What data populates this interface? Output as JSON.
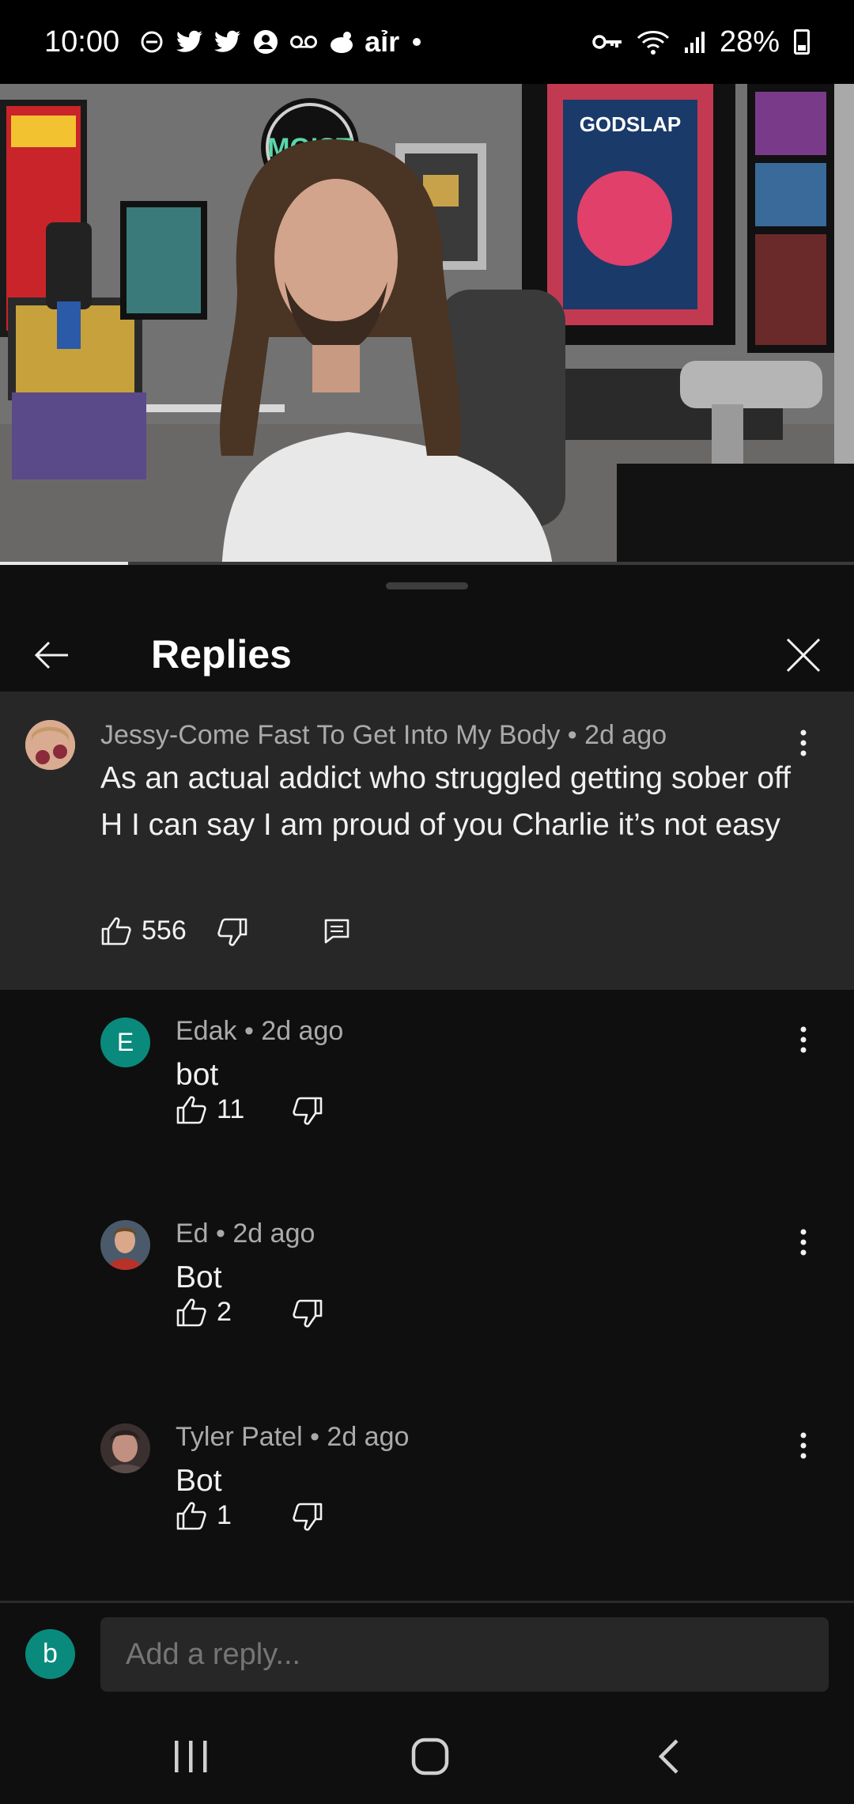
{
  "status_bar": {
    "time": "10:00",
    "battery": "28%",
    "left_icons": [
      "do-not-disturb-icon",
      "twitter-icon",
      "twitter-icon",
      "account-icon",
      "voicemail-icon",
      "notification-icon",
      "air-icon",
      "dot-icon"
    ],
    "right_icons": [
      "vpn-key-icon",
      "wifi-icon",
      "signal-icon",
      "battery-icon"
    ],
    "air_label": "aỉr"
  },
  "video": {
    "progress_percent": 15,
    "sign_text": "MOIST",
    "poster_text": "GODSLAP"
  },
  "sheet": {
    "title": "Replies"
  },
  "parent_comment": {
    "author": "Jessy-Come Fast To Get Into My Body",
    "age": "2d ago",
    "separator": " • ",
    "text": "As an actual addict who struggled getting sober off H I can say I am proud of you Charlie it’s not easy",
    "likes": "556"
  },
  "replies": [
    {
      "author": "Edak",
      "age": "2d ago",
      "text": "bot",
      "likes": "11",
      "avatar_letter": "E",
      "avatar_color": "#0a8a7c"
    },
    {
      "author": "Ed",
      "age": "2d ago",
      "text": "Bot",
      "likes": "2",
      "avatar_color": "#8a3a2a"
    },
    {
      "author": "Tyler Patel",
      "age": "2d ago",
      "text": "Bot",
      "likes": "1",
      "avatar_color": "#6b5a5a"
    }
  ],
  "composer": {
    "avatar_letter": "b",
    "avatar_color": "#0a8a7c",
    "placeholder": "Add a reply..."
  },
  "colors": {
    "background": "#0f0f0f",
    "parent_bg": "#272727",
    "meta_text": "#aaaaaa"
  }
}
